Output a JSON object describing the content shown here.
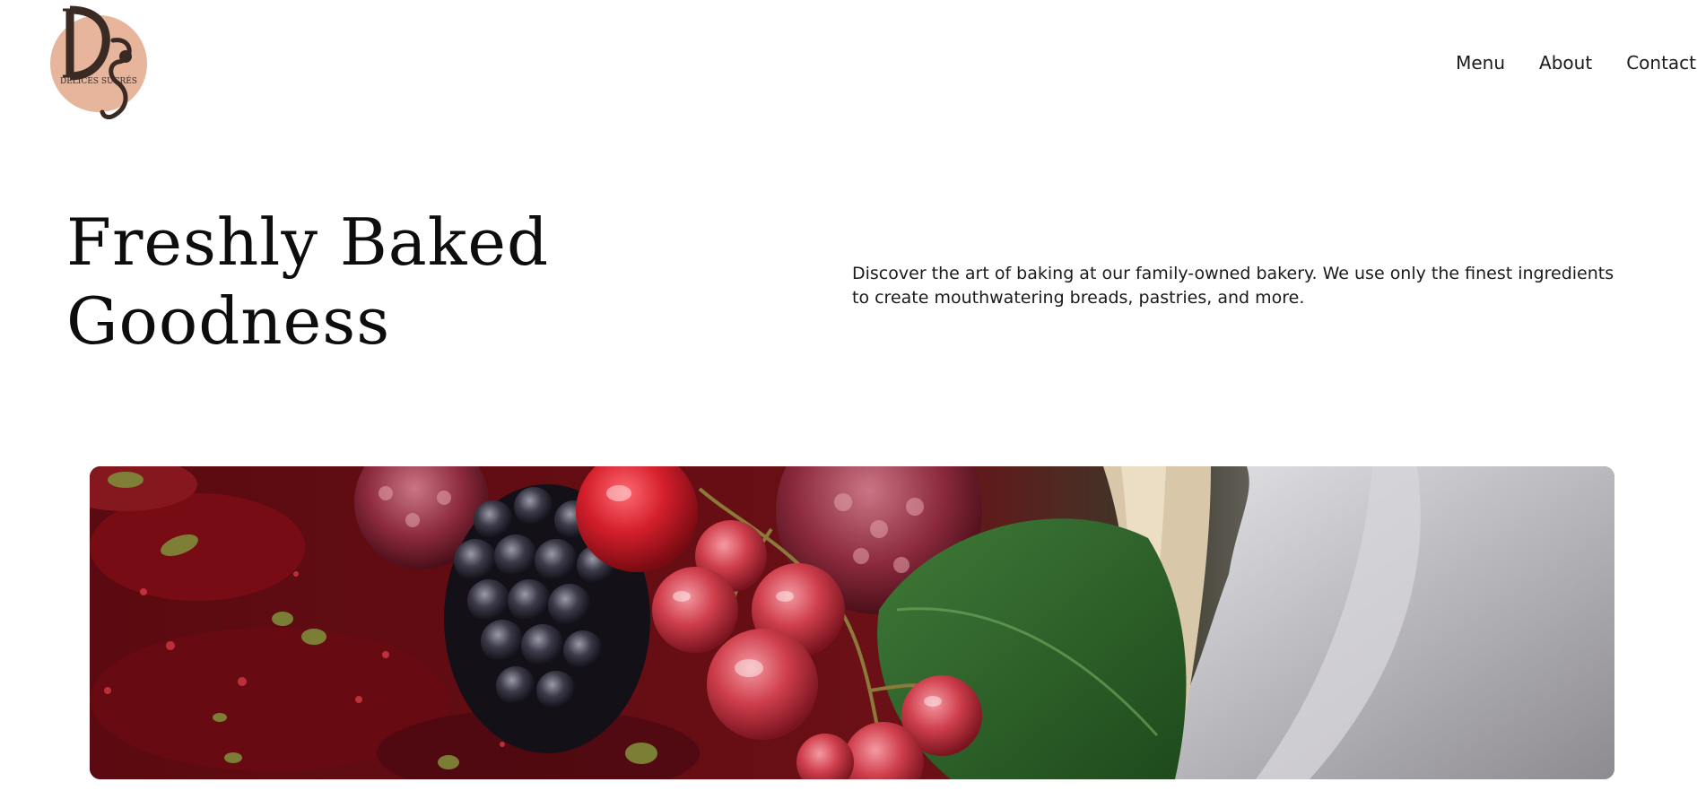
{
  "brand": {
    "monogram": "DS",
    "wordmark": "DÉLICES SUCRÉS",
    "logo_bg": "#e6b59b",
    "logo_ink": "#3a2a24"
  },
  "nav": {
    "items": [
      {
        "label": "Menu"
      },
      {
        "label": "About"
      },
      {
        "label": "Contact"
      }
    ]
  },
  "hero": {
    "title_line1": "Freshly Baked",
    "title_line2": "Goodness",
    "description": "Discover the art of baking at our family-owned bakery. We use only the finest ingredients to create mouthwatering breads, pastries, and more."
  },
  "banner": {
    "image_icon": "berries-photo"
  },
  "colors": {
    "background": "#ffffff",
    "text": "#111111",
    "accent": "#e6b59b"
  }
}
